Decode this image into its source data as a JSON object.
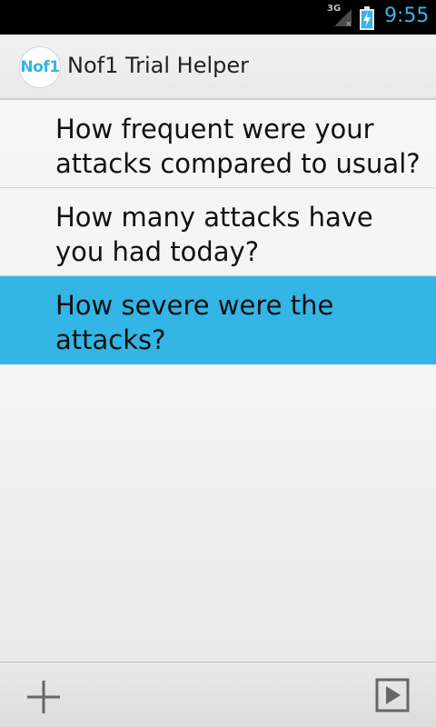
{
  "status_bar": {
    "network": "3G",
    "time": "9:55",
    "accent_color": "#33b5e5"
  },
  "action_bar": {
    "logo_text": "Nof1",
    "title": "Nof1 Trial Helper"
  },
  "questions": [
    {
      "label": "How frequent were your attacks compared to usual?"
    },
    {
      "label": "How many attacks have you had today?"
    },
    {
      "label": "How severe were the attacks?",
      "selected": true
    }
  ],
  "bottom_bar": {
    "add_icon": "plus-icon",
    "play_icon": "play-icon"
  }
}
